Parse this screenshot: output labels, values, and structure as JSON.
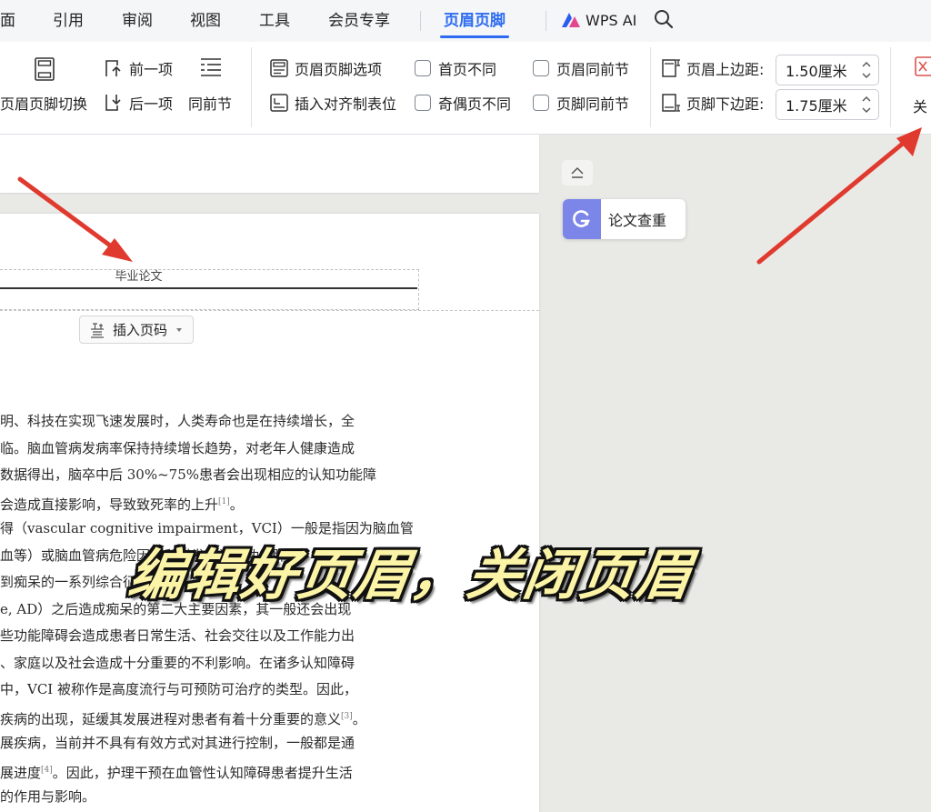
{
  "menubar": {
    "items": [
      {
        "label": "面"
      },
      {
        "label": "引用"
      },
      {
        "label": "审阅"
      },
      {
        "label": "视图"
      },
      {
        "label": "工具"
      },
      {
        "label": "会员专享"
      },
      {
        "label": "页眉页脚"
      }
    ],
    "wps_ai_label": "WPS AI",
    "active_item": "页眉页脚"
  },
  "ribbon": {
    "switch_label": "页眉页脚切换",
    "prev_label": "前一项",
    "next_label": "后一项",
    "same_prev_label": "同前节",
    "hf_options_label": "页眉页脚选项",
    "insert_align_tab_label": "插入对齐制表位",
    "first_page_diff": "首页不同",
    "odd_even_diff": "奇偶页不同",
    "header_same_prev": "页眉同前节",
    "footer_same_prev": "页脚同前节",
    "header_top_margin_label": "页眉上边距:",
    "header_top_margin_value": "1.50厘米",
    "footer_bottom_margin_label": "页脚下边距:",
    "footer_bottom_margin_value": "1.75厘米",
    "close_label_partial": "关"
  },
  "document": {
    "header_text": "毕业论文",
    "insert_page_number_label": "插入页码",
    "body_lines": [
      {
        "text": "明、科技在实现飞速发展时，人类寿命也是在持续增长，全",
        "cite": ""
      },
      {
        "text": "临。脑血管病发病率保持持续增长趋势，对老年人健康造成",
        "cite": ""
      },
      {
        "text": "数据得出，脑卒中后 30%~75%患者会出现相应的认知功能障",
        "cite": ""
      },
      {
        "text": "会造成直接影响，导致致死率的上升",
        "cite": "[1]"
      },
      {
        "text": "得（vascular cognitive impairment，VCI）一般是指因为脑血管",
        "cite": ""
      },
      {
        "text": "血等）或脑血管病危险因素所引发的认知功能障碍，涉及轻",
        "cite": ""
      },
      {
        "text": "到痴呆的一系列综合征",
        "cite": ""
      },
      {
        "text": "e, AD）之后造成痴呆的第二大主要因素，其一般还会出现",
        "cite": ""
      },
      {
        "text": "些功能障碍会造成患者日常生活、社会交往以及工作能力出",
        "cite": ""
      },
      {
        "text": "、家庭以及社会造成十分重要的不利影响。在诸多认知障碍",
        "cite": ""
      },
      {
        "text": "中，VCI 被称作是高度流行与可预防可治疗的类型。因此，",
        "cite": ""
      },
      {
        "text": "疾病的出现，延缓其发展进程对患者有着十分重要的意义",
        "cite": "[3]"
      },
      {
        "text": "展疾病，当前并不具有有效方式对其进行控制，一般都是通",
        "cite": ""
      },
      {
        "text": "展进度",
        "cite": "[4]",
        "after": "。因此，护理干预在血管性认知障碍患者提升生活"
      },
      {
        "text": "的作用与影响。",
        "cite": ""
      }
    ]
  },
  "side_panel": {
    "plagiarism_check_label": "论文查重"
  },
  "overlay": {
    "caption": "编辑好页眉，关闭页眉",
    "arrow_color": "#e03a2f",
    "caption_color": "#fbf3a6"
  }
}
